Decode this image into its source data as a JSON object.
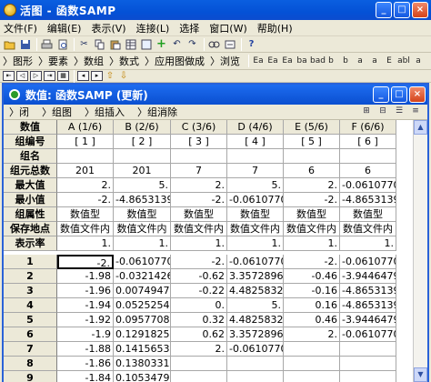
{
  "app": {
    "title": "活图 - 函数SAMP",
    "window_buttons": {
      "minimize": "_",
      "maximize": "□",
      "close": "×"
    }
  },
  "menu": [
    "文件(F)",
    "编辑(E)",
    "表示(V)",
    "连接(L)",
    "选择",
    "窗口(W)",
    "帮助(H)"
  ],
  "toolbar1": {
    "icons": [
      "folder-open-icon",
      "save-icon",
      "print-icon",
      "preview-icon",
      "cut-icon",
      "copy-icon",
      "paste-icon",
      "table-icon",
      "insert-icon",
      "add-icon",
      "undo-icon",
      "redo-icon",
      "find-icon",
      "replace-icon",
      "help-icon"
    ]
  },
  "toolbar2": {
    "labels": [
      "〉图形",
      "〉要素",
      "〉数组",
      "〉数式",
      "〉应用图做成",
      "〉浏览"
    ],
    "format_icons": [
      "Ea",
      "Ea",
      "Ea",
      "ba",
      "bad",
      "b",
      "b",
      "a",
      "a",
      "E",
      "abl",
      "a",
      "Ea",
      "a",
      "abl",
      "Σ",
      "Σ"
    ]
  },
  "inner": {
    "title": "数值: 函数SAMP (更新)",
    "toolbar": [
      "〉闭",
      "〉组图",
      "〉组插入",
      "〉组消除"
    ]
  },
  "grid": {
    "corner": "数值",
    "columns": [
      "A (1/6)",
      "B (2/6)",
      "C (3/6)",
      "D (4/6)",
      "E (5/6)",
      "F (6/6)"
    ],
    "header_rows": [
      {
        "label": "组编号",
        "cells": [
          "[ 1 ]",
          "[ 2 ]",
          "[ 3 ]",
          "[ 4 ]",
          "[ 5 ]",
          "[ 6 ]"
        ]
      },
      {
        "label": "组名",
        "cells": [
          "",
          "",
          "",
          "",
          "",
          ""
        ]
      },
      {
        "label": "组元总数",
        "cells": [
          "201",
          "201",
          "7",
          "7",
          "6",
          "6"
        ]
      },
      {
        "label": "最大值",
        "cells": [
          "2.",
          "5.",
          "2.",
          "5.",
          "2.",
          "-0.0610770"
        ]
      },
      {
        "label": "最小值",
        "cells": [
          "-2.",
          "-4.8653139",
          "-2.",
          "-0.0610770",
          "-2.",
          "-4.8653139"
        ]
      },
      {
        "label": "组属性",
        "cells": [
          "数值型",
          "数值型",
          "数值型",
          "数值型",
          "数值型",
          "数值型"
        ]
      },
      {
        "label": "保存地点",
        "cells": [
          "数值文件内",
          "数值文件内",
          "数值文件内",
          "数值文件内",
          "数值文件内",
          "数值文件内"
        ]
      },
      {
        "label": "表示率",
        "cells": [
          "1.",
          "1.",
          "1.",
          "1.",
          "1.",
          "1."
        ]
      }
    ],
    "data_rows": [
      {
        "label": "1",
        "cells": [
          "-2.",
          "-0.0610770",
          "-2.",
          "-0.0610770",
          "-2.",
          "-0.0610770"
        ]
      },
      {
        "label": "2",
        "cells": [
          "-1.98",
          "-0.0321426",
          "-0.62",
          "3.35728967",
          "-0.46",
          "-3.9446479"
        ]
      },
      {
        "label": "3",
        "cells": [
          "-1.96",
          "0.00749477",
          "-0.22",
          "4.48258327",
          "-0.16",
          "-4.8653139"
        ]
      },
      {
        "label": "4",
        "cells": [
          "-1.94",
          "0.05252547",
          "0.",
          "5.",
          "0.16",
          "-4.8653139"
        ]
      },
      {
        "label": "5",
        "cells": [
          "-1.92",
          "0.09577088",
          "0.32",
          "4.48258327",
          "0.46",
          "-3.9446479"
        ]
      },
      {
        "label": "6",
        "cells": [
          "-1.9",
          "0.12918253",
          "0.62",
          "3.35728967",
          "2.",
          "-0.0610770"
        ]
      },
      {
        "label": "7",
        "cells": [
          "-1.88",
          "0.14156537",
          "2.",
          "-0.0610770",
          "",
          ""
        ]
      },
      {
        "label": "8",
        "cells": [
          "-1.86",
          "0.13803312",
          "",
          "",
          "",
          ""
        ]
      },
      {
        "label": "9",
        "cells": [
          "-1.84",
          "0.10534798",
          "",
          "",
          "",
          ""
        ]
      }
    ]
  }
}
